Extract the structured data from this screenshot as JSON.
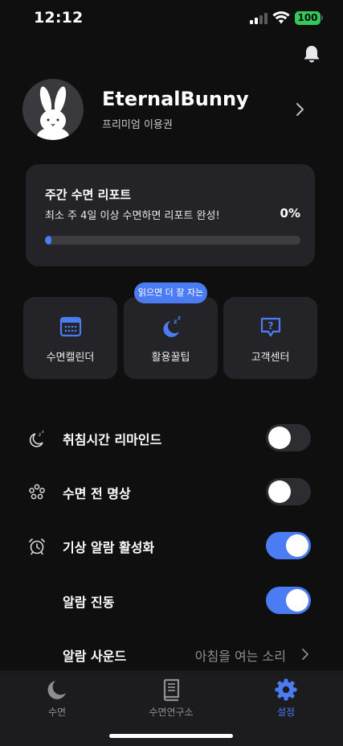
{
  "status_bar": {
    "time": "12:12",
    "battery": "100",
    "battery_color": "#34c759",
    "icons": [
      "signal-icon",
      "wifi-icon",
      "battery-icon"
    ]
  },
  "header": {
    "icons": [
      "bell-icon"
    ]
  },
  "profile": {
    "name": "EternalBunny",
    "plan": "프리미엄 이용권",
    "icons": [
      "rabbit-avatar",
      "chevron-right-icon"
    ]
  },
  "report": {
    "title": "주간 수면 리포트",
    "subtitle": "최소 주 4일 이상 수면하면 리포트 완성!",
    "percent_label": "0%",
    "progress": 0
  },
  "quick_actions": {
    "badge": "읽으면 더 잘 자는",
    "items": [
      {
        "label": "수면캘린더",
        "icon": "calendar-icon"
      },
      {
        "label": "활용꿀팁",
        "icon": "moon-zzz-icon"
      },
      {
        "label": "고객센터",
        "icon": "question-bubble-icon"
      }
    ]
  },
  "settings": [
    {
      "label": "취침시간 리마인드",
      "icon": "moon-zzz-icon",
      "toggle": false
    },
    {
      "label": "수면 전 명상",
      "icon": "meditation-icon",
      "toggle": false
    },
    {
      "label": "기상 알람 활성화",
      "icon": "alarm-clock-icon",
      "toggle": true
    },
    {
      "label": "알람 진동",
      "toggle": true
    },
    {
      "label": "알람 사운드",
      "value": "아침을 여는 소리",
      "icon": "chevron-right-icon"
    }
  ],
  "tab_bar": {
    "tabs": [
      {
        "label": "수면",
        "icon": "moon-icon",
        "active": false
      },
      {
        "label": "수면연구소",
        "icon": "book-icon",
        "active": false
      },
      {
        "label": "설정",
        "icon": "gear-icon",
        "active": true
      }
    ]
  },
  "colors": {
    "background": "#0f0f10",
    "card": "#242428",
    "accent": "#4b7cf3",
    "muted": "#8e8e93"
  }
}
